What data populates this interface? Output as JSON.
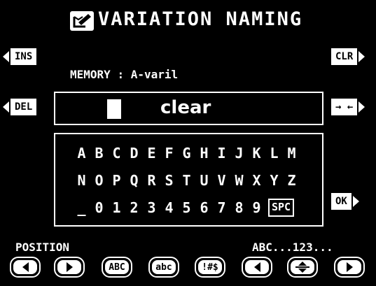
{
  "header": {
    "title": "VARIATION NAMING",
    "icon": "memory-edit-icon"
  },
  "side_buttons": {
    "ins": "INS",
    "del": "DEL",
    "clr": "CLR",
    "swap": "→ ←",
    "ok": "OK"
  },
  "memory": {
    "label": "MEMORY",
    "separator": ":",
    "value": "A-varil"
  },
  "name_field": {
    "value": "clear"
  },
  "characters": {
    "row1": [
      "A",
      "B",
      "C",
      "D",
      "E",
      "F",
      "G",
      "H",
      "I",
      "J",
      "K",
      "L",
      "M"
    ],
    "row2": [
      "N",
      "O",
      "P",
      "Q",
      "R",
      "S",
      "T",
      "U",
      "V",
      "W",
      "X",
      "Y",
      "Z"
    ],
    "row3": [
      "_",
      "0",
      "1",
      "2",
      "3",
      "4",
      "5",
      "6",
      "7",
      "8",
      "9"
    ],
    "spc": "SPC"
  },
  "footer": {
    "position_label": "POSITION",
    "mode_label": "ABC...123...",
    "buttons": {
      "upper": "ABC",
      "lower": "abc",
      "symbols": "!#$"
    }
  },
  "colors": {
    "background": "#000000",
    "foreground": "#ffffff"
  }
}
